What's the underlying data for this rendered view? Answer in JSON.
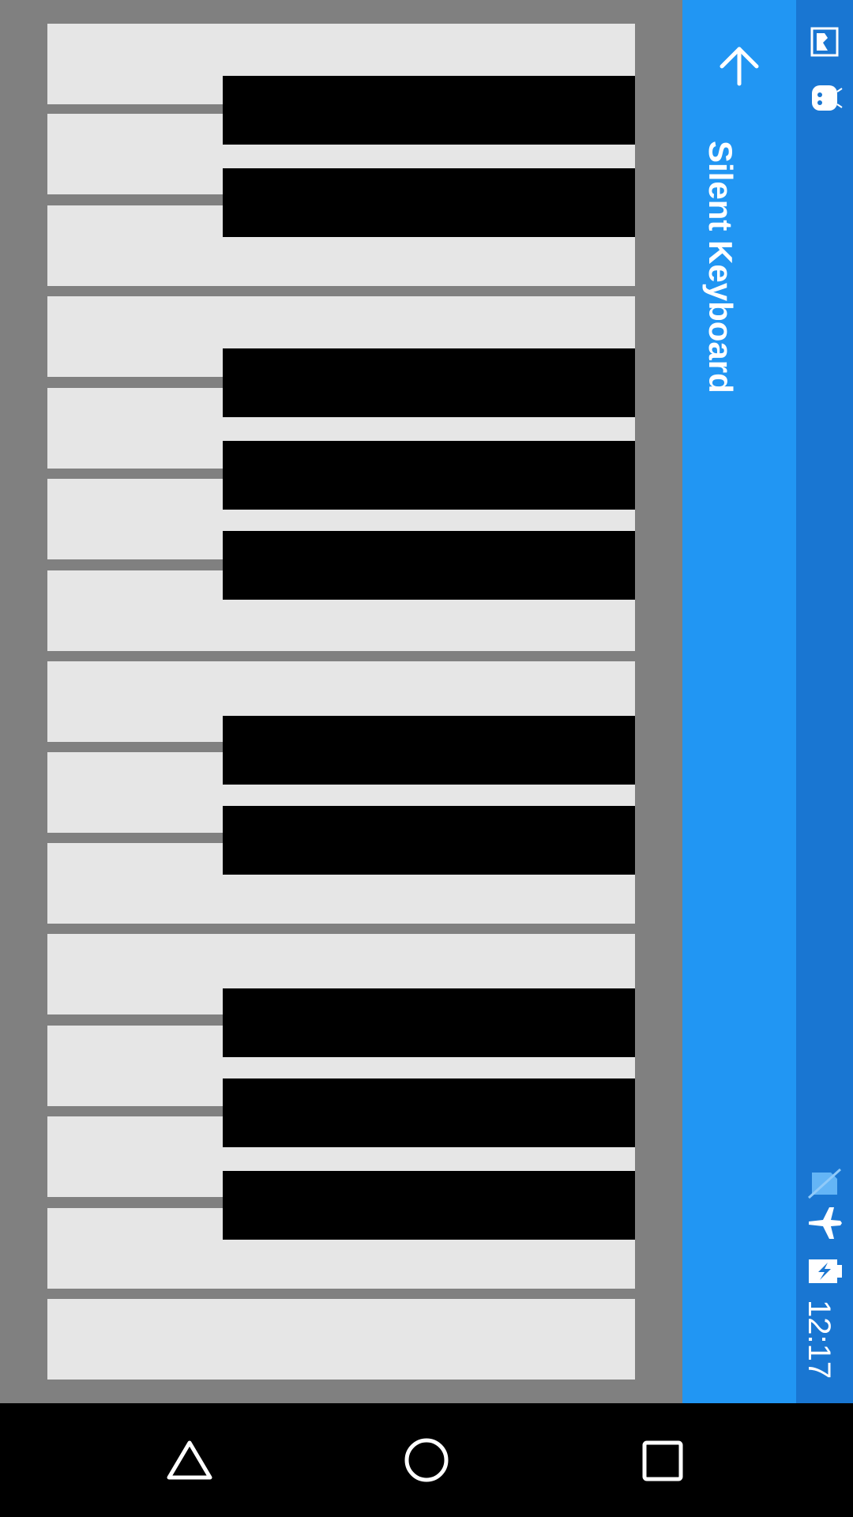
{
  "app_bar": {
    "title": "Silent Keyboard",
    "back_icon": "arrow-back-icon",
    "color": "#2196F3"
  },
  "status_bar": {
    "time": "12:17",
    "icons": [
      "image-notification-icon",
      "android-debug-icon",
      "no-sim-icon",
      "airplane-mode-icon",
      "battery-charging-icon"
    ],
    "color": "#1976D2"
  },
  "keyboard": {
    "white_key_count": 15,
    "black_key_count": 10,
    "white_key_color": "#E6E6E6",
    "black_key_color": "#000000",
    "background_color": "#808080"
  },
  "nav_bar": {
    "icons": [
      "back-triangle-icon",
      "home-circle-icon",
      "recents-square-icon"
    ]
  }
}
